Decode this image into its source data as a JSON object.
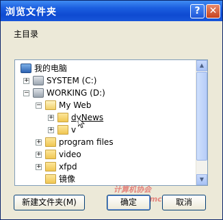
{
  "window": {
    "title": "浏览文件夹",
    "help_label": "?",
    "close_label": "✕"
  },
  "prompt": "主目录",
  "tree": [
    {
      "label": "我的电脑",
      "icon": "computer-icon",
      "expander": ""
    },
    {
      "label": "SYSTEM (C:)",
      "icon": "drive-icon",
      "expander": "+"
    },
    {
      "label": "WORKING (D:)",
      "icon": "drive-icon",
      "expander": "−"
    },
    {
      "label": "My Web",
      "icon": "folder-open-icon",
      "expander": "−"
    },
    {
      "label": "dyNews",
      "icon": "folder-icon",
      "expander": "+"
    },
    {
      "label": "v",
      "icon": "folder-icon",
      "expander": "+"
    },
    {
      "label": "program files",
      "icon": "folder-icon",
      "expander": "+"
    },
    {
      "label": "video",
      "icon": "folder-icon",
      "expander": "+"
    },
    {
      "label": "xfpd",
      "icon": "folder-icon",
      "expander": "+"
    },
    {
      "label": "镜像",
      "icon": "folder-icon",
      "expander": ""
    }
  ],
  "buttons": {
    "new_folder": "新建文件夹(M)",
    "ok": "确定",
    "cancel": "取消"
  },
  "watermark": "计算机协会 www.gxjmcd.com"
}
